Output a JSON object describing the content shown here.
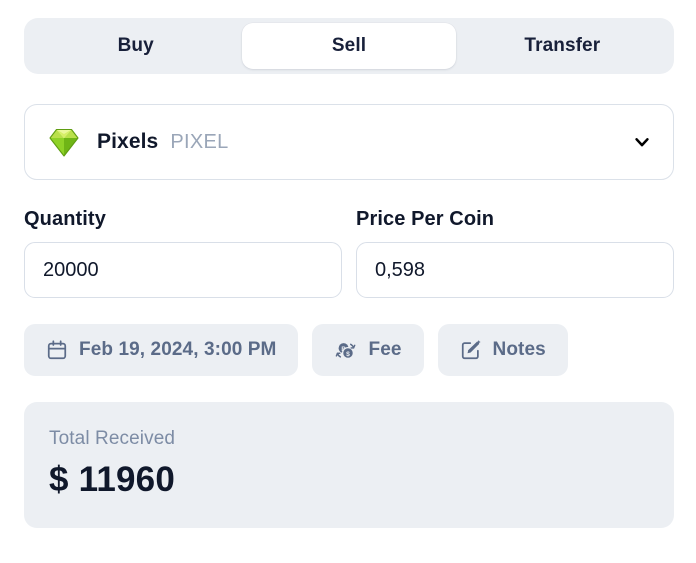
{
  "tabs": [
    {
      "label": "Buy",
      "active": false
    },
    {
      "label": "Sell",
      "active": true
    },
    {
      "label": "Transfer",
      "active": false
    }
  ],
  "coin_select": {
    "name": "Pixels",
    "ticker": "PIXEL",
    "logo_icon": "green-gem-icon",
    "chevron_icon": "chevron-down-icon"
  },
  "fields": {
    "quantity": {
      "label": "Quantity",
      "value": "20000",
      "placeholder": "Quantity"
    },
    "price_per_coin": {
      "label": "Price Per Coin",
      "value": "0,598",
      "placeholder": "Price Per Coin"
    }
  },
  "chips": [
    {
      "label": "Feb 19, 2024, 3:00 PM",
      "icon": "calendar-icon"
    },
    {
      "label": "Fee",
      "icon": "coins-exchange-icon"
    },
    {
      "label": "Notes",
      "icon": "edit-pencil-icon"
    }
  ],
  "total": {
    "label": "Total Received",
    "value": "$ 11960"
  },
  "colors": {
    "panel_bg": "#eceff3",
    "text_dark": "#10182b",
    "text_slate": "#5b6b88",
    "text_muted": "#7d8ca5",
    "ticker_muted": "#9aa6b8",
    "border": "#d9dfe8",
    "gem_light": "#c3e63b",
    "gem_mid": "#9ad42a",
    "gem_dark": "#6bb31c"
  }
}
